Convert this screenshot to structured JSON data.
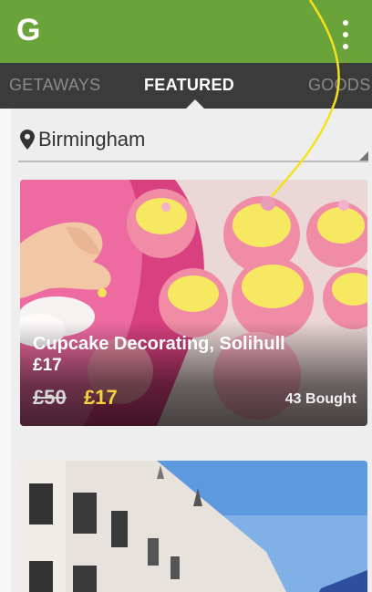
{
  "app": {
    "logo_letter": "G",
    "brand_color": "#6aa33a",
    "menu_icon": "overflow-menu-icon"
  },
  "tabs": [
    {
      "label": "GETAWAYS",
      "selected": false
    },
    {
      "label": "FEATURED",
      "selected": true
    },
    {
      "label": "GOODS",
      "selected": false
    }
  ],
  "location": {
    "icon": "map-pin-icon",
    "label": "Birmingham"
  },
  "deals": [
    {
      "title": "Cupcake Decorating, Solihull",
      "price_line": "£17",
      "old_price": "£50",
      "new_price": "£17",
      "bought": "43 Bought",
      "image": "cupcakes-photo"
    },
    {
      "image": "building-photo"
    }
  ],
  "colors": {
    "tab_bar": "#3b3b3b",
    "price_highlight": "#f5d43b",
    "annotation_line": "#f4e21a"
  }
}
